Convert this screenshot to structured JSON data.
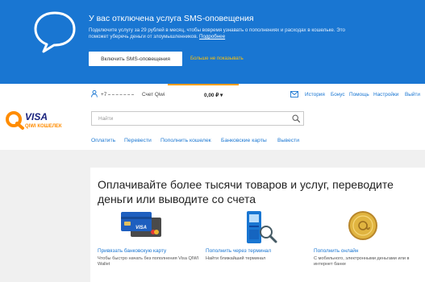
{
  "banner": {
    "title": "У вас отключена услуга SMS-оповещения",
    "text": "Подключите услугу за 29 рублей в месяц, чтобы вовремя узнавать о пополнениях и расходах в кошельке. Это поможет уберечь деньги от злоумышленников. ",
    "link": "Подробнее",
    "button": "Включить SMS-оповещения",
    "dismiss": "Больше не показывать"
  },
  "topbar": {
    "phone_prefix": "+7",
    "wallet_label": "Счет Qiwi",
    "balance": "0,00 ₽ ▾",
    "links": [
      "История",
      "Бонус",
      "Помощь",
      "Настройки",
      "Выйти"
    ]
  },
  "logo": {
    "visa": "VISA",
    "wallet": "QIWI КОШЕЛЕК"
  },
  "search": {
    "placeholder": "Найти",
    "value": ""
  },
  "menu": [
    "Оплатить",
    "Перевести",
    "Пополнить кошелек",
    "Банковские карты",
    "Вывести"
  ],
  "content": {
    "headline": "Оплачивайте более тысячи товаров и услуг, переводите деньги или выводите со счета",
    "features": [
      {
        "link": "Привязать банковскую карту",
        "desc": "Чтобы быстро начать без пополнения Visa QIWI Wallet"
      },
      {
        "link": "Пополнить через терминал",
        "desc": "Найти ближайший терминал"
      },
      {
        "link": "Пополнить онлайн",
        "desc": "С мобильного, электронными деньгами или в интернет банке"
      }
    ],
    "card_brand": "VISA"
  },
  "colors": {
    "brand_blue": "#1976d2",
    "accent_orange": "#ff8c00",
    "link": "#1976d2"
  }
}
